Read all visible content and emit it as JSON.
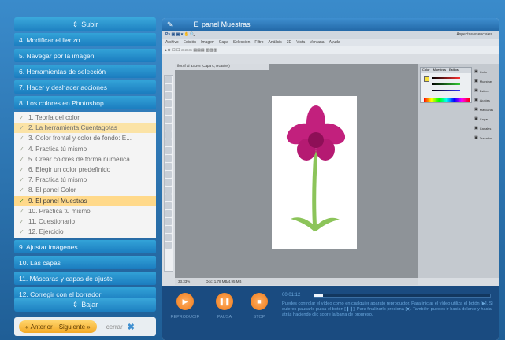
{
  "left_panel": {
    "up_label": "Subir",
    "down_label": "Bajar",
    "sections_top": [
      "4. Modificar el lienzo",
      "5. Navegar por la imagen",
      "6. Herramientas de selección",
      "7. Hacer y deshacer acciones",
      "8. Los colores en Photoshop"
    ],
    "subitems": [
      "1. Teoría del color",
      "2. La herramienta Cuentagotas",
      "3. Color frontal y color de fondo: E...",
      "4. Practica tú mismo",
      "5. Crear colores de forma numérica",
      "6. Elegir un color predefinido",
      "7. Practica tú mismo",
      "8. El panel Color",
      "9. El panel Muestras",
      "10. Practica tú mismo",
      "11. Cuestionario",
      "12. Ejercicio"
    ],
    "highlighted_index": 1,
    "current_index": 8,
    "sections_bottom": [
      "9. Ajustar imágenes",
      "10. Las capas",
      "11. Máscaras y capas de ajuste",
      "12. Corregir con el borrador"
    ],
    "nav": {
      "prev": "Anterior",
      "next": "Siguiente",
      "close": "cerrar"
    }
  },
  "player": {
    "title": "El panel Muestras",
    "menu": [
      "Archivo",
      "Edición",
      "Imagen",
      "Capa",
      "Selección",
      "Filtro",
      "Análisis",
      "3D",
      "Vista",
      "Ventana",
      "Ayuda"
    ],
    "workspace": "Aspectos esenciales",
    "doc_tab": "flor.tif al 33,3% (Capa 0, RGB/8#)",
    "zoom": "33,33%",
    "doc_info": "Doc: 1,78 MB/4,95 MB",
    "panel_tabs": [
      "Color",
      "Muestras",
      "Estilos"
    ],
    "side_panels": [
      "Color",
      "Muestras",
      "Estilos",
      "Ajustes",
      "Máscaras",
      "Capas",
      "Canales",
      "Trazados"
    ],
    "controls": {
      "play": "REPRODUCIR",
      "pause": "PAUSA",
      "stop": "STOP"
    },
    "time": "00:01:12",
    "progress": 0.05,
    "help": "Puedes controlar el vídeo como en cualquier aparato reproductor. Para iniciar el vídeo utiliza el botón [▶]. Si quieres pausarlo pulsa el botón [❚❚]. Para finalizarlo presiona [■]. También puedes ir hacia delante y hacia atrás haciendo clic sobre la barra de progreso."
  }
}
